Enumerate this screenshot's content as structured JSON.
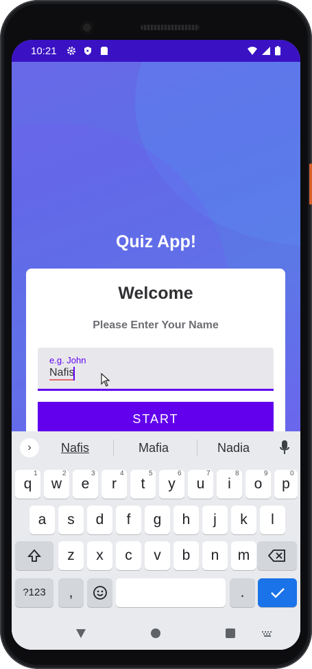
{
  "status": {
    "time": "10:21"
  },
  "app": {
    "title": "Quiz App!"
  },
  "card": {
    "welcome": "Welcome",
    "prompt": "Please Enter Your Name",
    "name_label": "e.g. John",
    "name_value": "Nafis",
    "start_label": "START"
  },
  "keyboard": {
    "suggestions": [
      "Nafis",
      "Mafia",
      "Nadia"
    ],
    "row1": [
      "q",
      "w",
      "e",
      "r",
      "t",
      "y",
      "u",
      "i",
      "o",
      "p"
    ],
    "row1_hints": [
      "1",
      "2",
      "3",
      "4",
      "5",
      "6",
      "7",
      "8",
      "9",
      "0"
    ],
    "row2": [
      "a",
      "s",
      "d",
      "f",
      "g",
      "h",
      "j",
      "k",
      "l"
    ],
    "row3": [
      "z",
      "x",
      "c",
      "v",
      "b",
      "n",
      "m"
    ],
    "symbols_label": "?123",
    "comma": ",",
    "period": "."
  },
  "colors": {
    "accent": "#6200ee",
    "statusbar": "#3a12c4",
    "keyboard_enter": "#1a73e8"
  }
}
